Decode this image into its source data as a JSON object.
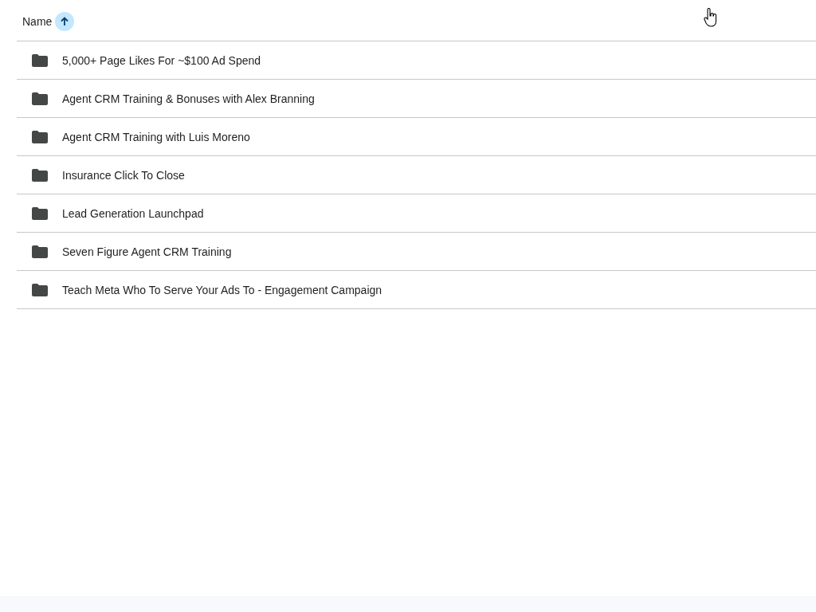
{
  "header": {
    "label": "Name",
    "sort_ascending": true
  },
  "items": [
    {
      "kind": "folder",
      "name": "5,000+ Page Likes For ~$100 Ad Spend"
    },
    {
      "kind": "folder",
      "name": "Agent CRM Training & Bonuses with Alex Branning"
    },
    {
      "kind": "folder",
      "name": "Agent CRM Training with Luis Moreno"
    },
    {
      "kind": "folder",
      "name": "Insurance Click To Close"
    },
    {
      "kind": "folder",
      "name": "Lead Generation Launchpad"
    },
    {
      "kind": "folder",
      "name": "Seven Figure Agent CRM Training"
    },
    {
      "kind": "folder",
      "name": "Teach Meta Who To Serve Your Ads To - Engagement Campaign"
    }
  ]
}
